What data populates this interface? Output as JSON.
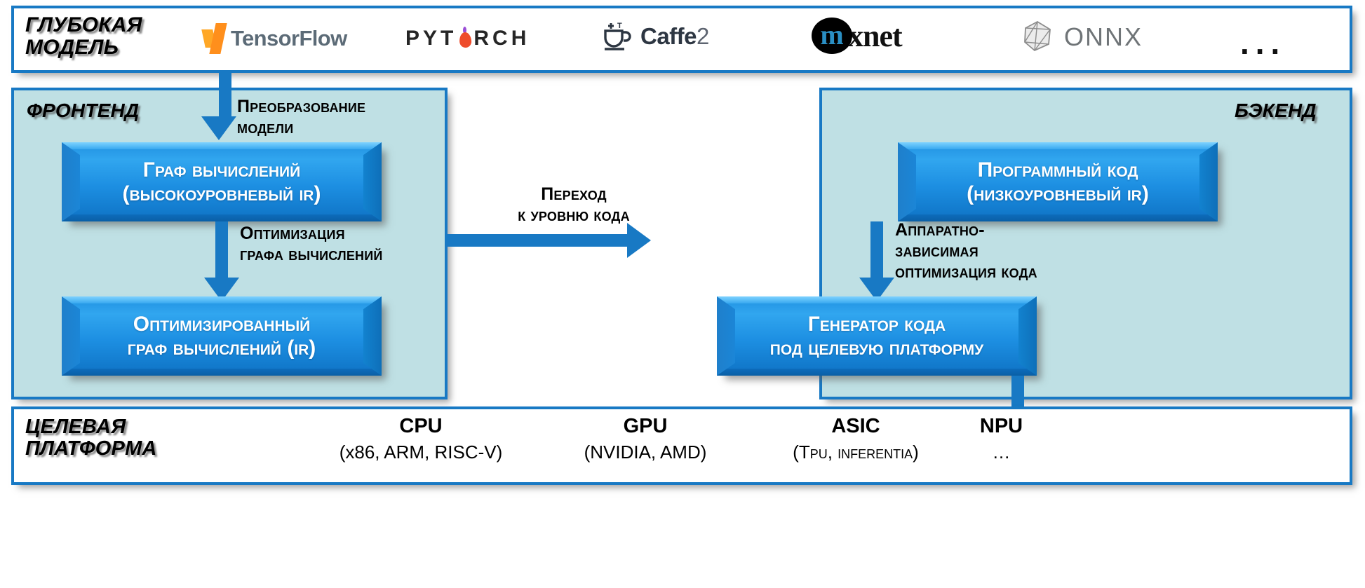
{
  "diagram": {
    "title_implicit": "Структура компилятора глубоких моделей",
    "accent_blue": "#1879c4",
    "panel_tint": "#bfe0e4",
    "box_blue": "#1d8fe2"
  },
  "top_row": {
    "caption": "ГЛУБОКАЯ\nМОДЕЛЬ",
    "frameworks": [
      {
        "name": "TensorFlow",
        "icon": "tensorflow-logo"
      },
      {
        "name": "PYT RCH",
        "icon": "pytorch-logo"
      },
      {
        "name": "Caffe",
        "suffix": "2",
        "icon": "caffe2-logo"
      },
      {
        "name": "xnet",
        "badge": "m",
        "icon": "mxnet-logo"
      },
      {
        "name": "ONNX",
        "icon": "onnx-logo"
      }
    ],
    "ellipsis": "..."
  },
  "frontend": {
    "caption": "ФРОНТЕНД",
    "arrow_model_convert": "Преобразование\nмодели",
    "box_graph": "Граф вычислений\n(высокоуровневый IR)",
    "arrow_graph_opt": "Оптимизация\nграфа вычислений",
    "box_optimized": "Оптимизированный\nграф вычислений (IR)"
  },
  "middle": {
    "arrow_transition": "Переход\nк уровню кода"
  },
  "backend": {
    "caption": "БЭКЕНД",
    "box_code": "Программный код\n(низкоуровневый IR)",
    "arrow_hw_opt": "Аппаратно-\nзависимая\nоптимизация кода",
    "box_codegen": "Генератор кода\nпод целевую платформу"
  },
  "bottom_row": {
    "caption": "ЦЕЛЕВАЯ\nПЛАТФОРМА",
    "platforms": [
      {
        "name": "CPU",
        "desc": "(x86, ARM, RISC-V)"
      },
      {
        "name": "GPU",
        "desc": "(NVIDIA, AMD)"
      },
      {
        "name": "ASIC",
        "desc": "(TPU, Inferentia)"
      },
      {
        "name": "NPU",
        "desc": "…"
      }
    ]
  }
}
